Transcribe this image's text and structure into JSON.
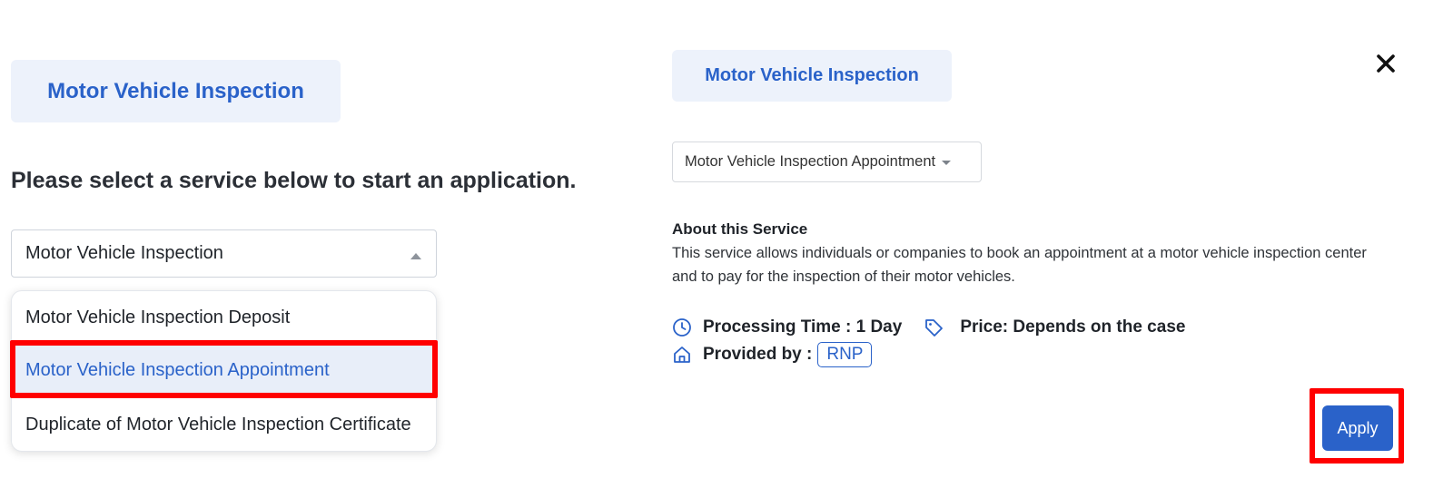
{
  "left_panel": {
    "badge": "Motor Vehicle Inspection",
    "heading": "Please select a service below to start an application.",
    "select": {
      "value": "Motor Vehicle Inspection",
      "expanded": true
    },
    "options": [
      {
        "label": "Motor Vehicle Inspection Deposit"
      },
      {
        "label": "Motor Vehicle Inspection Appointment",
        "highlighted": true
      },
      {
        "label": "Duplicate of Motor Vehicle Inspection Certificate"
      }
    ]
  },
  "right_panel": {
    "badge": "Motor Vehicle Inspection",
    "service_select": {
      "value": "Motor Vehicle Inspection Appointment"
    },
    "about": {
      "title": "About this Service",
      "text": "This service allows individuals or companies to book an appointment at a motor vehicle inspection center and to pay for the inspection of their motor vehicles."
    },
    "processing_time": "Processing Time : 1 Day",
    "price": "Price: Depends on the case",
    "provided_by_label": "Provided by :",
    "provider": "RNP",
    "apply_label": "Apply"
  },
  "icons": {
    "close": "close-icon",
    "clock": "clock-icon",
    "price_tag": "tag-icon",
    "provider": "home-icon",
    "select_caret_up": "caret-up-icon",
    "select_caret_down": "caret-down-icon"
  },
  "colors": {
    "accent": "#2a62c9",
    "badge_bg": "#edf2fb",
    "selected_option_bg": "#e8eef9",
    "highlight": "#ff0000"
  }
}
